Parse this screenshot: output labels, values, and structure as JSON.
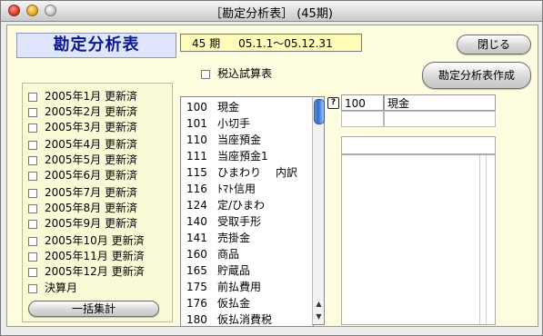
{
  "window": {
    "title": "［勘定分析表］ (45期)"
  },
  "heading": "勘定分析表",
  "period": {
    "term": "45 期",
    "range": "05.1.1～05.12.31"
  },
  "buttons": {
    "close": "閉じる",
    "make": "勘定分析表作成",
    "sum": "一括集計"
  },
  "tax_checkbox": {
    "label": "税込試算表",
    "checked": false
  },
  "months": [
    {
      "label": "2005年1月 更新済",
      "checked": false
    },
    {
      "label": "2005年2月 更新済",
      "checked": false
    },
    {
      "label": "2005年3月 更新済",
      "checked": false
    },
    {
      "label": "2005年4月 更新済",
      "checked": false
    },
    {
      "label": "2005年5月 更新済",
      "checked": false
    },
    {
      "label": "2005年6月 更新済",
      "checked": false
    },
    {
      "label": "2005年7月 更新済",
      "checked": false
    },
    {
      "label": "2005年8月 更新済",
      "checked": false
    },
    {
      "label": "2005年9月 更新済",
      "checked": false
    },
    {
      "label": "2005年10月 更新済",
      "checked": false
    },
    {
      "label": "2005年11月 更新済",
      "checked": false
    },
    {
      "label": "2005年12月 更新済",
      "checked": false
    },
    {
      "label": "決算月",
      "checked": false
    }
  ],
  "accounts": [
    {
      "code": "100",
      "name": "現金",
      "extra": ""
    },
    {
      "code": "101",
      "name": "小切手",
      "extra": ""
    },
    {
      "code": "110",
      "name": "当座預金",
      "extra": ""
    },
    {
      "code": "111",
      "name": "当座預金1",
      "extra": ""
    },
    {
      "code": "115",
      "name": "ひまわり",
      "extra": "内訳"
    },
    {
      "code": "116",
      "name": "ﾄﾏﾄ信用",
      "extra": ""
    },
    {
      "code": "124",
      "name": "定/ひまわ",
      "extra": ""
    },
    {
      "code": "140",
      "name": "受取手形",
      "extra": ""
    },
    {
      "code": "141",
      "name": "売掛金",
      "extra": ""
    },
    {
      "code": "160",
      "name": "商品",
      "extra": ""
    },
    {
      "code": "165",
      "name": "貯蔵品",
      "extra": ""
    },
    {
      "code": "175",
      "name": "前払費用",
      "extra": ""
    },
    {
      "code": "176",
      "name": "仮払金",
      "extra": ""
    },
    {
      "code": "180",
      "name": "仮払消費税",
      "extra": ""
    }
  ],
  "selected": {
    "code": "100",
    "name": "現金"
  },
  "icons": {
    "help": "?",
    "scroll_up": "▲",
    "scroll_down": "▼"
  }
}
